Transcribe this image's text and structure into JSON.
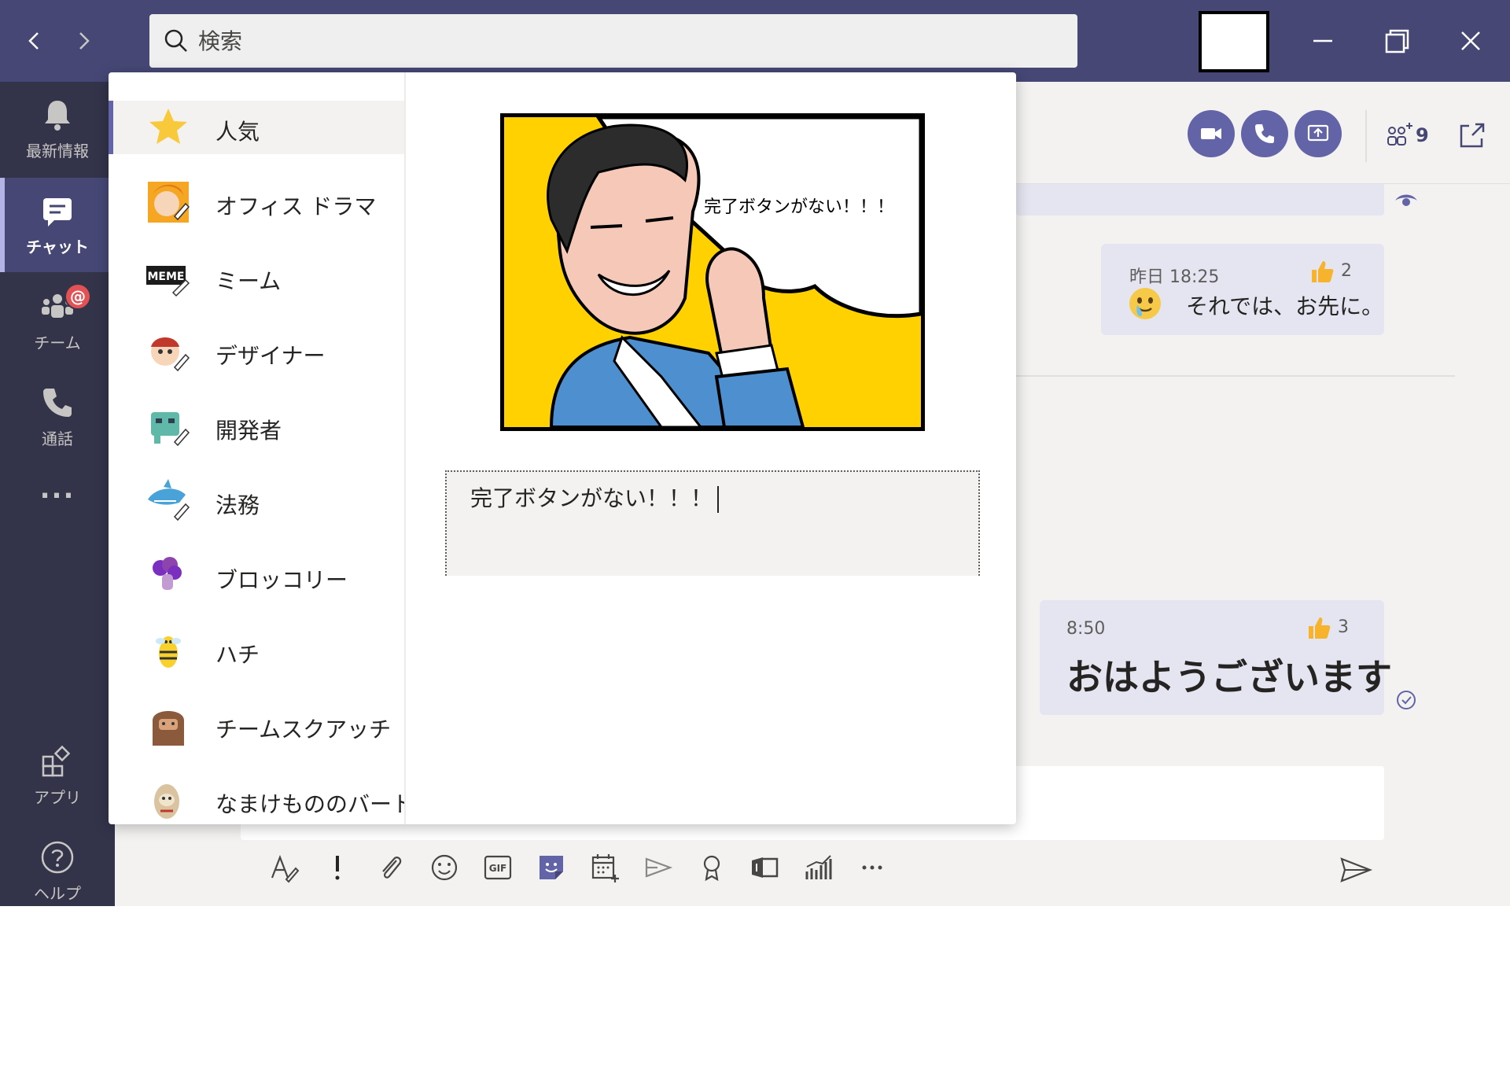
{
  "search": {
    "placeholder": "検索"
  },
  "rail": {
    "items": [
      {
        "label": "最新情報",
        "icon": "bell-icon"
      },
      {
        "label": "チャット",
        "icon": "chat-icon"
      },
      {
        "label": "チーム",
        "icon": "teams-icon",
        "badge": "@"
      },
      {
        "label": "通話",
        "icon": "phone-icon"
      },
      {
        "label": "...",
        "icon": "more-icon"
      },
      {
        "label": "アプリ",
        "icon": "apps-icon"
      },
      {
        "label": "ヘルプ",
        "icon": "help-icon"
      }
    ],
    "active_index": 1
  },
  "header": {
    "participant_count": "9"
  },
  "messages": [
    {
      "time": "昨日 18:25",
      "likes": "2",
      "text": "それでは、お先に。",
      "emoji": "face-emoji"
    },
    {
      "time": "8:50",
      "likes": "3",
      "text": "おはようございます"
    }
  ],
  "sticker_picker": {
    "categories": [
      {
        "label": "人気",
        "icon": "star-icon"
      },
      {
        "label": "オフィス ドラマ",
        "icon": "office-drama-icon"
      },
      {
        "label": "ミーム",
        "icon": "meme-icon"
      },
      {
        "label": "デザイナー",
        "icon": "designer-icon"
      },
      {
        "label": "開発者",
        "icon": "developer-icon"
      },
      {
        "label": "法務",
        "icon": "legal-shark-icon"
      },
      {
        "label": "ブロッコリー",
        "icon": "broccoli-icon"
      },
      {
        "label": "ハチ",
        "icon": "bee-icon"
      },
      {
        "label": "チームスクアッチ",
        "icon": "squatch-icon"
      },
      {
        "label": "なまけもののバート",
        "icon": "sloth-icon"
      }
    ],
    "selected_index": 0,
    "preview_caption": "完了ボタンがない！！！",
    "caption_input_value": "完了ボタンがない！！！"
  },
  "colors": {
    "titlebar": "#464775",
    "rail": "#33344a",
    "accent": "#6264a7",
    "bubble": "#e5e5f1"
  }
}
